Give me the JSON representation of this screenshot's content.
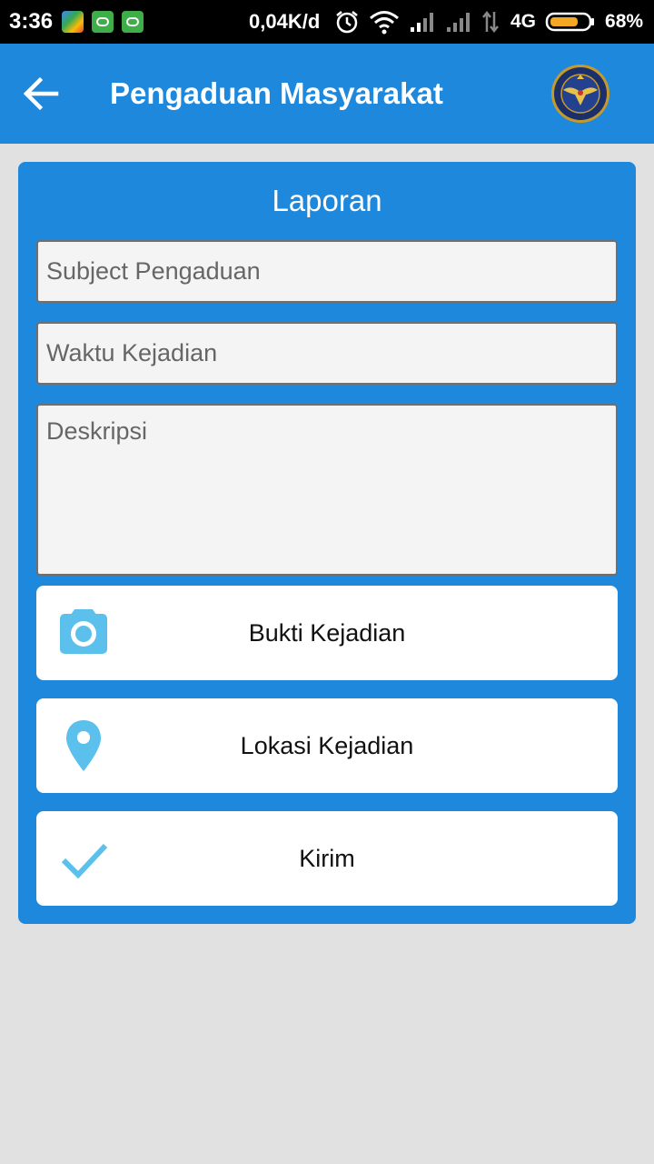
{
  "status_bar": {
    "time": "3:36",
    "net_speed": "0,04K/d",
    "network_type": "4G",
    "battery": "68%",
    "icons": [
      "google-play-icon",
      "cat-app-icon",
      "cat-app-icon",
      "alarm-icon",
      "wifi-icon",
      "signal-icon",
      "signal-icon",
      "data-arrows-icon",
      "battery-icon"
    ]
  },
  "app_bar": {
    "title": "Pengaduan Masyarakat",
    "back_icon": "arrow-left-icon",
    "logo_icon": "emblem-logo-icon"
  },
  "form": {
    "title": "Laporan",
    "subject_placeholder": "Subject Pengaduan",
    "subject_value": "",
    "time_placeholder": "Waktu Kejadian",
    "time_value": "",
    "description_placeholder": "Deskripsi",
    "description_value": "",
    "evidence_button": "Bukti Kejadian",
    "location_button": "Lokasi Kejadian",
    "submit_button": "Kirim"
  },
  "colors": {
    "primary": "#1e88dc",
    "icon_accent": "#5bc0eb",
    "background": "#e1e1e1"
  }
}
